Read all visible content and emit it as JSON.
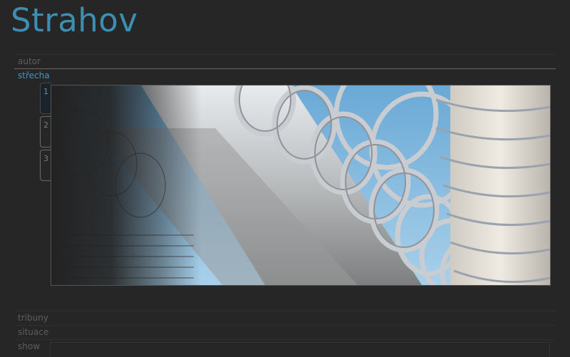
{
  "site": {
    "title": "Strahov"
  },
  "sections": {
    "autor": "autor",
    "strecha": "střecha",
    "tribuny": "tribuny",
    "situace": "situace",
    "show": "show"
  },
  "gallery": {
    "tabs": [
      "1",
      "2",
      "3"
    ],
    "active_tab": "1",
    "image_description": "architectural render of a roof made of steel tube hoops against blue sky"
  },
  "colors": {
    "background": "#262626",
    "accent": "#3c8fb3",
    "muted_text": "#5e5e5e",
    "sky": "#7fb6dc"
  }
}
